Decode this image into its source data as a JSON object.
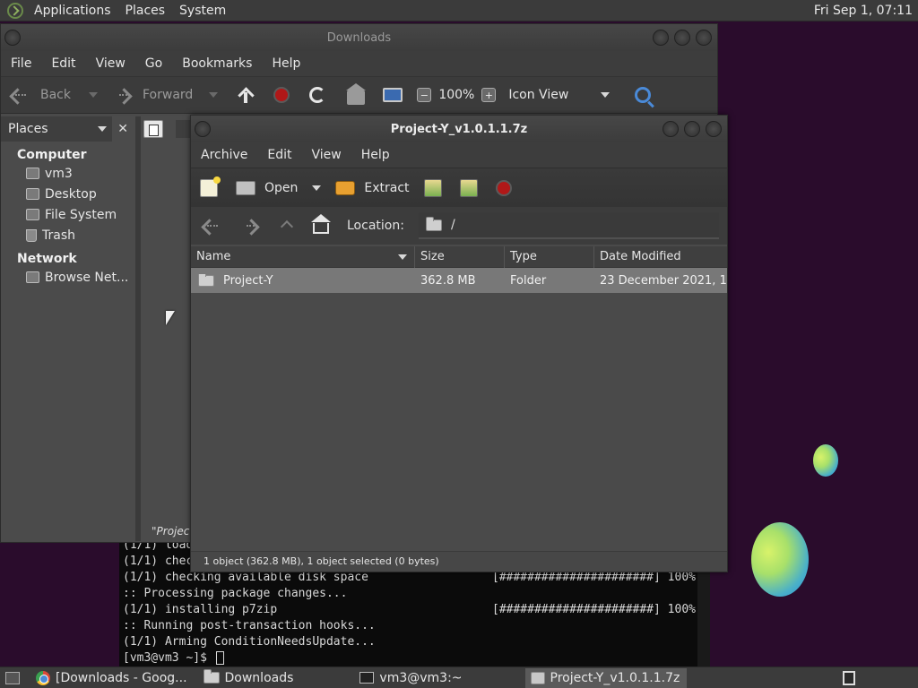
{
  "top_panel": {
    "menus": [
      "Applications",
      "Places",
      "System"
    ],
    "clock": "Fri Sep  1, 07:11"
  },
  "downloads_window": {
    "title": "Downloads",
    "menu": [
      "File",
      "Edit",
      "View",
      "Go",
      "Bookmarks",
      "Help"
    ],
    "toolbar": {
      "back": "Back",
      "forward": "Forward",
      "zoom": "100%",
      "view_mode": "Icon View"
    },
    "sidebar": {
      "header": "Places",
      "computer_label": "Computer",
      "computer_items": [
        "vm3",
        "Desktop",
        "File System",
        "Trash"
      ],
      "network_label": "Network",
      "network_items": [
        "Browse Net..."
      ]
    },
    "status": "\"Project"
  },
  "archive_window": {
    "title": "Project-Y_v1.0.1.1.7z",
    "menu": [
      "Archive",
      "Edit",
      "View",
      "Help"
    ],
    "toolbar": {
      "open": "Open",
      "extract": "Extract"
    },
    "location_label": "Location:",
    "location_value": "/",
    "columns": [
      "Name",
      "Size",
      "Type",
      "Date Modified"
    ],
    "rows": [
      {
        "name": "Project-Y",
        "size": "362.8 MB",
        "type": "Folder",
        "date": "23 December 2021, 1..."
      }
    ],
    "status": "1 object (362.8 MB), 1 object selected (0 bytes)"
  },
  "terminal": {
    "lines": [
      {
        "left": "(1/1) load",
        "right": ""
      },
      {
        "left": "(1/1) chec",
        "right": ""
      },
      {
        "left": "(1/1) checking available disk space",
        "right": "[######################] 100%"
      },
      {
        "left": ":: Processing package changes...",
        "right": ""
      },
      {
        "left": "(1/1) installing p7zip",
        "right": "[######################] 100%"
      },
      {
        "left": ":: Running post-transaction hooks...",
        "right": ""
      },
      {
        "left": "(1/1) Arming ConditionNeedsUpdate...",
        "right": ""
      }
    ],
    "prompt": "[vm3@vm3 ~]$ "
  },
  "taskbar": {
    "tasks": [
      "[Downloads - Goog...",
      "Downloads",
      "vm3@vm3:~",
      "Project-Y_v1.0.1.1.7z"
    ]
  },
  "colors": {
    "desktop_bg": "#2a0c2c",
    "stop_red": "#b01818",
    "search_blue": "#4a8ad8"
  }
}
